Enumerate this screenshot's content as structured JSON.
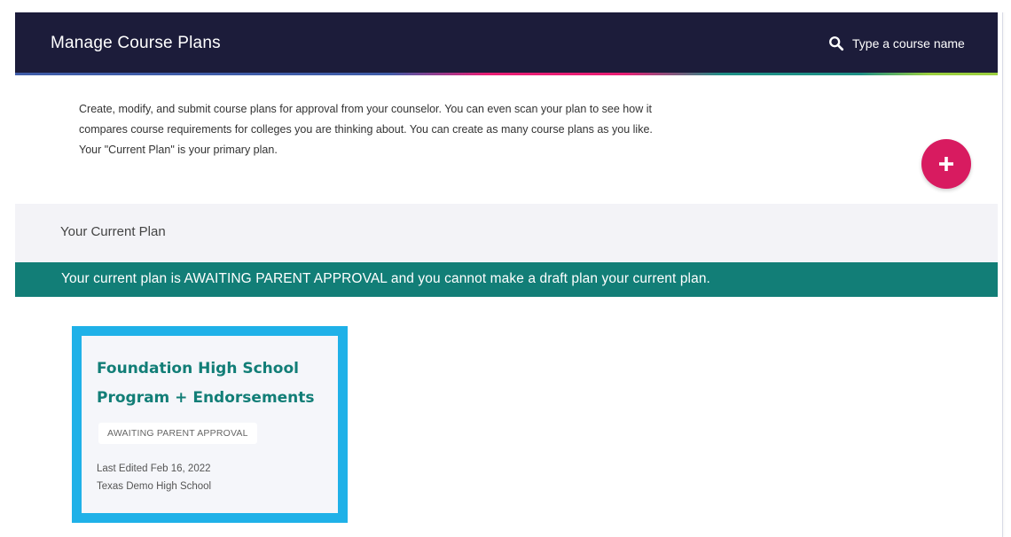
{
  "header": {
    "title": "Manage Course Plans",
    "search_placeholder": "Type a course name"
  },
  "intro": {
    "lines": [
      "Create, modify, and submit course plans for approval from your counselor. You can even scan your plan to see how it",
      "compares course requirements for colleges you are thinking about. You can create as many course plans as you like.",
      "Your \"Current Plan\" is your primary plan."
    ]
  },
  "section": {
    "title": "Your Current Plan"
  },
  "banner": {
    "message": "Your current plan is AWAITING PARENT APPROVAL and you cannot make a draft plan your current plan."
  },
  "plan_card": {
    "title_lines": [
      "Foundation High School",
      "Program + Endorsements"
    ],
    "status": "AWAITING PARENT APPROVAL",
    "last_edited": "Last Edited Feb 16, 2022",
    "school": "Texas Demo High School"
  },
  "colors": {
    "header_bg": "#1c1c3a",
    "accent_pink": "#d81b60",
    "teal": "#127e77",
    "card_border": "#1fb1e8"
  },
  "icons": {
    "search": "search-icon",
    "add": "plus-icon"
  }
}
